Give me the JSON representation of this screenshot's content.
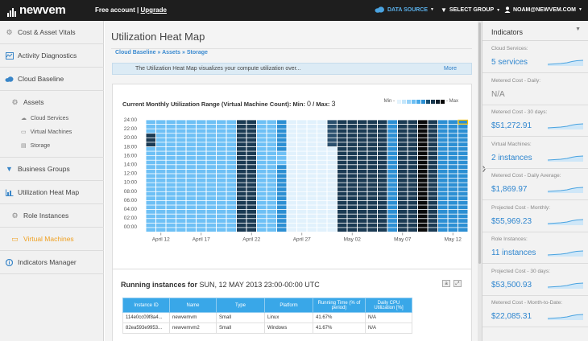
{
  "app": {
    "logo_text": "newvem",
    "account": "Free account",
    "separator": "|",
    "upgrade": "Upgrade",
    "nav": {
      "data_source": "DATA SOURCE",
      "select_group": "SELECT GROUP",
      "user": "NOAM@NEWVEM.COM"
    }
  },
  "sidebar": {
    "items": [
      {
        "label": "Cost & Asset Vitals",
        "icon": "gear-icon"
      },
      {
        "label": "Activity Diagnostics",
        "icon": "diagnostics-icon"
      },
      {
        "label": "Cloud Baseline",
        "icon": "cloud-icon"
      },
      {
        "label": "Assets",
        "icon": "assets-gear-icon"
      },
      {
        "label": "Business Groups",
        "icon": "filter-icon"
      },
      {
        "label": "Utilization Heat Map",
        "icon": "heatmap-icon"
      },
      {
        "label": "Role Instances",
        "icon": "role-icon"
      },
      {
        "label": "Virtual Machines",
        "icon": "vm-icon"
      },
      {
        "label": "Indicators Manager",
        "icon": "info-icon"
      }
    ],
    "asset_subitems": [
      "Cloud Services",
      "Virtual Machines",
      "Storage"
    ]
  },
  "page": {
    "title": "Utilization Heat Map",
    "breadcrumb": "Cloud Baseline » Assets » Storage",
    "info_text": "The Utilization Heat Map visualizes your compute utilization over...",
    "info_more": "More"
  },
  "heatmap": {
    "title": "Current Monthly Utilization Range (Virtual Machine Count): Min: ",
    "min": "0",
    "sep": " / Max: ",
    "max": "3",
    "legend_min": "Min -",
    "legend_max": "- Max",
    "legend_colors": [
      "#e3f3fd",
      "#c4e6fb",
      "#97d2f8",
      "#6dbff4",
      "#46a8e8",
      "#2a8fd4",
      "#1a4f70",
      "#16364d",
      "#0f1f2b",
      "#050505"
    ]
  },
  "chart_data": {
    "type": "heatmap",
    "title": "Current Monthly Utilization Range (Virtual Machine Count)",
    "y_labels": [
      "00:00",
      "02:00",
      "04:00",
      "06:00",
      "08:00",
      "10:00",
      "12:00",
      "14:00",
      "16:00",
      "18:00",
      "20:00",
      "22:00",
      "24:00"
    ],
    "x_labels": [
      "April 12",
      "April 17",
      "April 22",
      "April 27",
      "May 02",
      "May 07",
      "May 12"
    ],
    "value_range": {
      "min": 0,
      "max": 3
    }
  },
  "running": {
    "title": "Running instances for",
    "datetime": "SUN, 12 MAY 2013 23:00-00:00 UTC",
    "columns": [
      "Instance ID",
      "Name",
      "Type",
      "Platform",
      "Running Time (% of period)",
      "Daily CPU Utilization [%]"
    ],
    "rows": [
      [
        "114e0cc09f8a4...",
        "newvemvm",
        "Small",
        "Linux",
        "41.67%",
        "N/A"
      ],
      [
        "82ea593e9953...",
        "newvemvm2",
        "Small",
        "Windows",
        "41.67%",
        "N/A"
      ]
    ]
  },
  "indicators": {
    "title": "Indicators",
    "items": [
      {
        "label": "Cloud Services:",
        "value": "5 services"
      },
      {
        "label": "Metered Cost - Daily:",
        "value": "N/A"
      },
      {
        "label": "Metered Cost - 30 days:",
        "value": "$51,272.91"
      },
      {
        "label": "Virtual Machines:",
        "value": "2 instances"
      },
      {
        "label": "Metered Cost - Daily Average:",
        "value": "$1,869.97"
      },
      {
        "label": "Projected Cost - Monthly:",
        "value": "$55,969.23"
      },
      {
        "label": "Role Instances:",
        "value": "11 instances"
      },
      {
        "label": "Projected Cost - 30 days:",
        "value": "$53,500.93"
      },
      {
        "label": "Metered Cost - Month-to-Date:",
        "value": "$22,085.31"
      }
    ]
  }
}
